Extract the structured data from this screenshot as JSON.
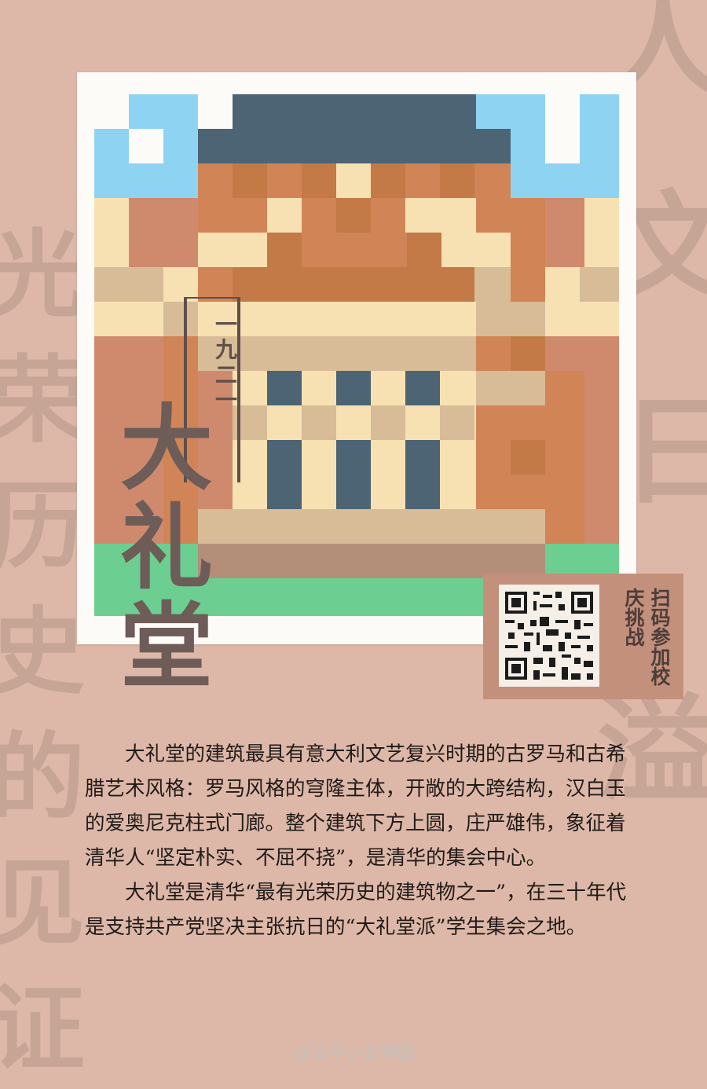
{
  "background_glyphs": [
    "光",
    "荣",
    "历",
    "史",
    "的",
    "见",
    "证",
    "人",
    "文",
    "日",
    "溢"
  ],
  "year": "一九二一",
  "title": "大礼堂",
  "qr": {
    "caption": "扫码参加校庆挑战"
  },
  "body": {
    "paragraphs": [
      "大礼堂的建筑最具有意大利文艺复兴时期的古罗马和古希腊艺术风格：罗马风格的穹隆主体，开敞的大跨结构，汉白玉的爱奥尼克柱式门廊。整个建筑下方上圆，庄严雄伟，象征着清华人“坚定朴实、不屈不挠”，是清华的集会中心。",
      "大礼堂是清华“最有光荣历史的建筑物之一”，在三十年代是支持共产党坚决主张抗日的“大礼堂派”学生集会之地。"
    ]
  },
  "watermark": "@清华小五爷园",
  "colors": {
    "background": "#ddb8a8",
    "sky": "#8fd3f3",
    "roof": "#4c6473",
    "brick": "#d18455",
    "brick_dark": "#c37a47",
    "cream": "#f7e1b3",
    "sand": "#d8bc98",
    "lawn": "#6ccf91",
    "text": "#1f1a18",
    "title": "#6e5c58"
  }
}
